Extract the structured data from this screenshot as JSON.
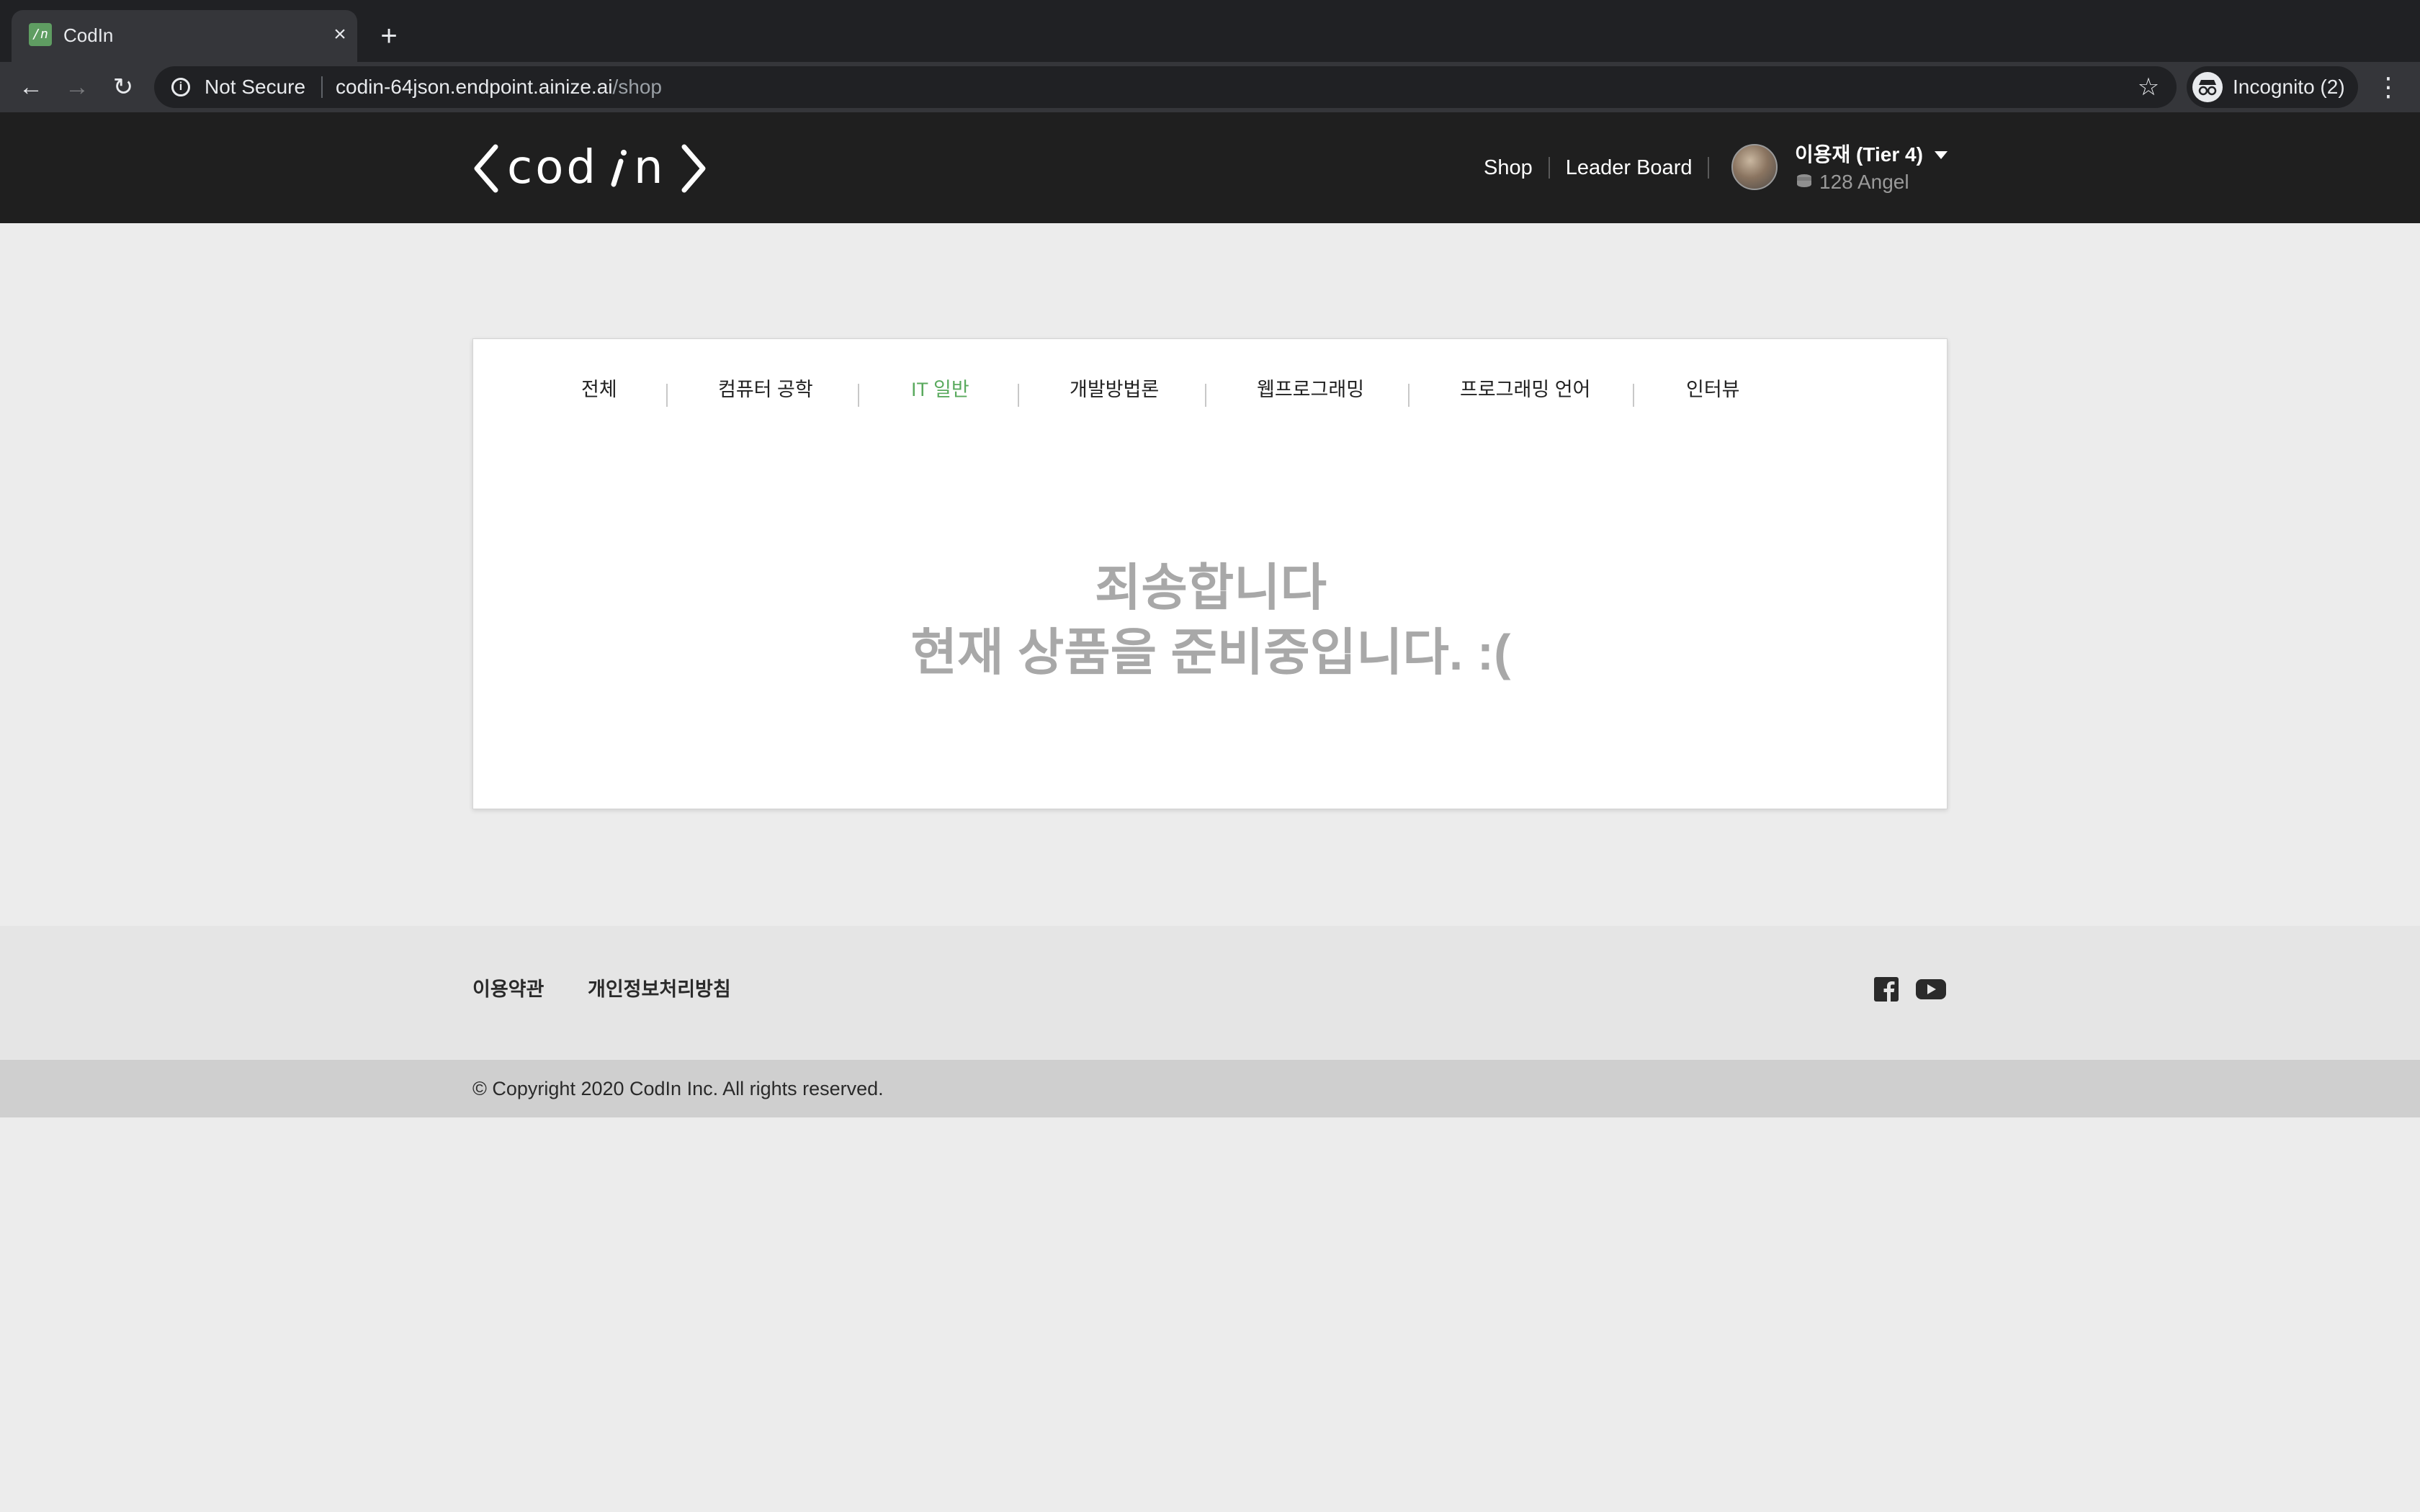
{
  "browser": {
    "tab_title": "CodIn",
    "favicon_text": "/n",
    "close_glyph": "×",
    "new_tab_glyph": "+",
    "security_label": "Not Secure",
    "url_host": "codin-64json.endpoint.ainize.ai",
    "url_path": "/shop",
    "incognito_label": "Incognito (2)"
  },
  "header": {
    "logo_alt": "<codin>",
    "nav": [
      {
        "label": "Shop"
      },
      {
        "label": "Leader Board"
      }
    ],
    "user": {
      "name": "이용재 (Tier 4)",
      "points": "128 Angel"
    }
  },
  "categories": [
    {
      "label": "전체",
      "active": false
    },
    {
      "label": "컴퓨터 공학",
      "active": false
    },
    {
      "label": "IT 일반",
      "active": true
    },
    {
      "label": "개발방법론",
      "active": false
    },
    {
      "label": "웹프로그래밍",
      "active": false
    },
    {
      "label": "프로그래밍 언어",
      "active": false
    },
    {
      "label": "인터뷰",
      "active": false
    }
  ],
  "empty_state": {
    "line1": "죄송합니다",
    "line2": "현재 상품을 준비중입니다. :("
  },
  "footer": {
    "links": [
      {
        "label": "이용약관"
      },
      {
        "label": "개인정보처리방침"
      }
    ],
    "copyright": "© Copyright 2020 CodIn Inc. All rights reserved."
  },
  "colors": {
    "header_bg": "#1f1f1f",
    "page_bg": "#ececec",
    "active_category": "#5aaa5e",
    "empty_text": "#a8a8a8"
  },
  "icons": [
    "back-icon",
    "forward-icon",
    "reload-icon",
    "info-icon",
    "star-icon",
    "incognito-icon",
    "menu-icon",
    "coin-icon",
    "caret-down-icon",
    "facebook-icon",
    "youtube-icon"
  ]
}
